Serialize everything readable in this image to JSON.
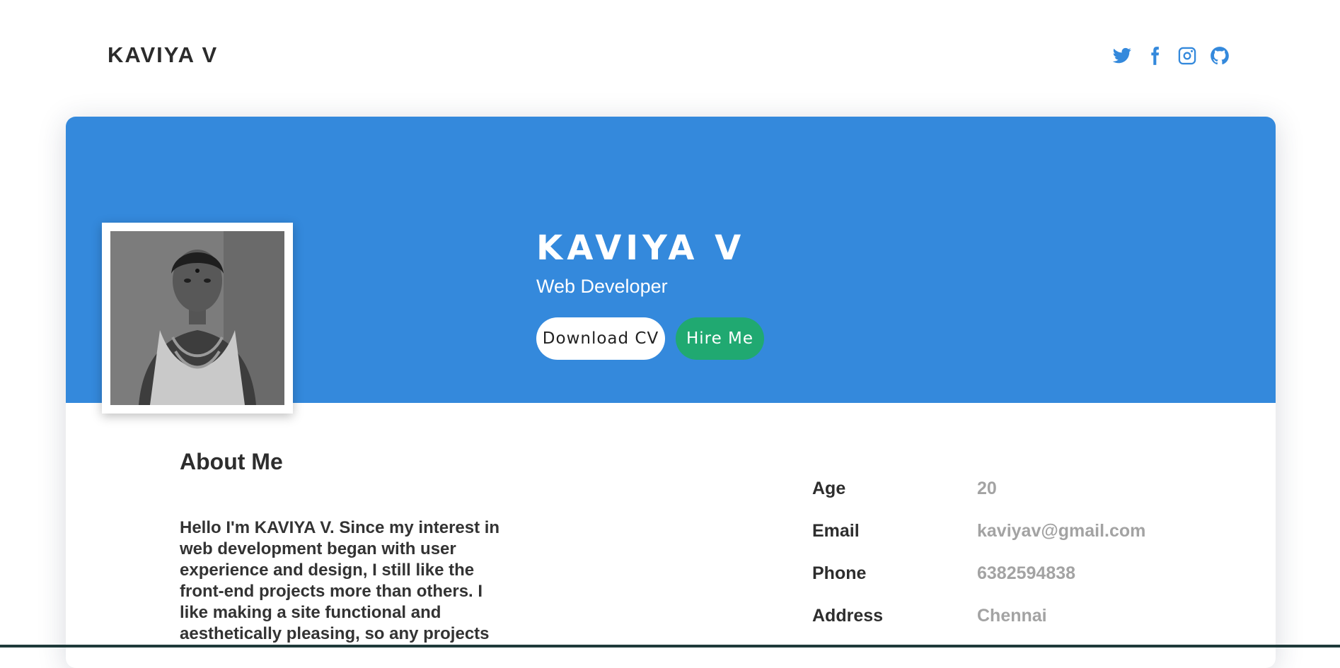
{
  "header": {
    "brand": "KAVIYA V",
    "social": [
      {
        "icon": "twitter-icon"
      },
      {
        "icon": "facebook-icon"
      },
      {
        "icon": "instagram-icon"
      },
      {
        "icon": "github-icon"
      }
    ]
  },
  "hero": {
    "name": "KAVIYA V",
    "role": "Web Developer",
    "download_label": "Download CV",
    "hire_label": "Hire Me"
  },
  "about": {
    "title": "About Me",
    "text": "Hello I'm KAVIYA V. Since my interest in web development began with user experience and design, I still like the front-end projects more than others. I like making a site functional and aesthetically pleasing, so any projects"
  },
  "info": [
    {
      "label": "Age",
      "value": "20"
    },
    {
      "label": "Email",
      "value": "kaviyav@gmail.com"
    },
    {
      "label": "Phone",
      "value": "6382594838"
    },
    {
      "label": "Address",
      "value": "Chennai"
    }
  ],
  "colors": {
    "accent": "#3489dc",
    "hire": "#20a971",
    "muted": "#a3a3a3"
  }
}
